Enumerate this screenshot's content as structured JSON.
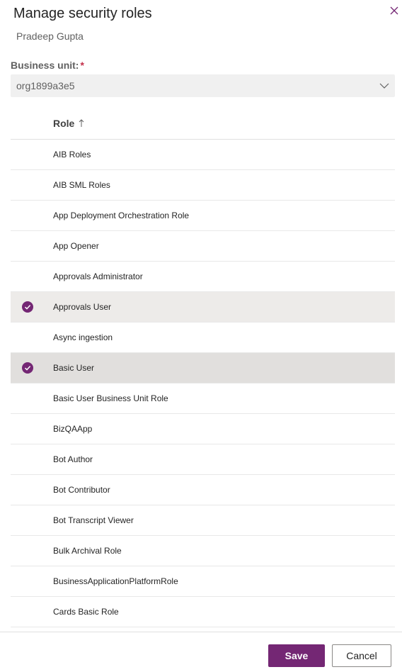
{
  "dialog": {
    "title": "Manage security roles",
    "subtitle": "Pradeep Gupta"
  },
  "business_unit": {
    "label": "Business unit:",
    "required_marker": "*",
    "value": "org1899a3e5"
  },
  "grid": {
    "column_header": "Role",
    "sort_indicator": "ascending",
    "rows": [
      {
        "name": "AIB Roles",
        "selected": false
      },
      {
        "name": "AIB SML Roles",
        "selected": false
      },
      {
        "name": "App Deployment Orchestration Role",
        "selected": false
      },
      {
        "name": "App Opener",
        "selected": false
      },
      {
        "name": "Approvals Administrator",
        "selected": false
      },
      {
        "name": "Approvals User",
        "selected": true
      },
      {
        "name": "Async ingestion",
        "selected": false
      },
      {
        "name": "Basic User",
        "selected": true
      },
      {
        "name": "Basic User Business Unit Role",
        "selected": false
      },
      {
        "name": "BizQAApp",
        "selected": false
      },
      {
        "name": "Bot Author",
        "selected": false
      },
      {
        "name": "Bot Contributor",
        "selected": false
      },
      {
        "name": "Bot Transcript Viewer",
        "selected": false
      },
      {
        "name": "Bulk Archival Role",
        "selected": false
      },
      {
        "name": "BusinessApplicationPlatformRole",
        "selected": false
      },
      {
        "name": "Cards Basic Role",
        "selected": false
      }
    ]
  },
  "footer": {
    "save_label": "Save",
    "cancel_label": "Cancel"
  },
  "colors": {
    "accent": "#742774",
    "selected_row": "#edebe9",
    "focused_row": "#e1dfdd"
  }
}
